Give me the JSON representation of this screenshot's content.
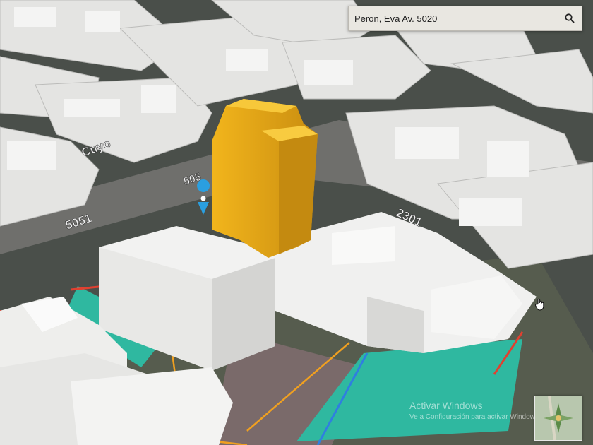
{
  "search": {
    "value": "Peron, Eva Av. 5020",
    "icon": "search-icon"
  },
  "map": {
    "street_labels": [
      "Cuyo",
      "5051",
      "505",
      "2301"
    ],
    "highlight_color": "#e3a81b",
    "marker_color": "#2a9fe0",
    "parcel_fill": "#2fb8a0",
    "parcel_outline_orange": "#f0a020",
    "parcel_outline_blue": "#2f7fe0",
    "parcel_outline_red": "#e04030"
  },
  "watermark": {
    "title": "Activar Windows",
    "subtitle": "Ve a Configuración para activar Windows."
  },
  "overview_map": {
    "icon": "compass-rose-icon"
  },
  "cursor": {
    "icon": "hand-cursor-icon"
  }
}
